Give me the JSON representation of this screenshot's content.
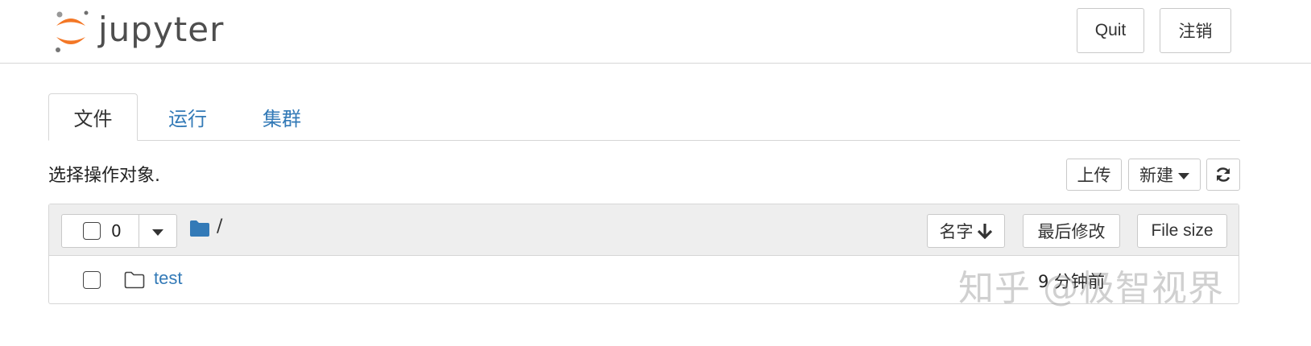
{
  "header": {
    "logo_text": "jupyter",
    "quit_label": "Quit",
    "logout_label": "注销"
  },
  "tabs": [
    {
      "label": "文件",
      "active": true
    },
    {
      "label": "运行",
      "active": false
    },
    {
      "label": "集群",
      "active": false
    }
  ],
  "toolbar": {
    "hint": "选择操作对象.",
    "upload_label": "上传",
    "new_label": "新建",
    "refresh_icon": "refresh-icon"
  },
  "list": {
    "selected_count": "0",
    "breadcrumb": "/",
    "sort_name_label": "名字",
    "sort_modified_label": "最后修改",
    "sort_size_label": "File size",
    "items": [
      {
        "name": "test",
        "type": "folder",
        "modified": "9 分钟前"
      }
    ]
  },
  "watermark": "知乎 @极智视界",
  "colors": {
    "link": "#337ab7",
    "logo_orange": "#f37726",
    "header_bg": "#eeeeee"
  }
}
